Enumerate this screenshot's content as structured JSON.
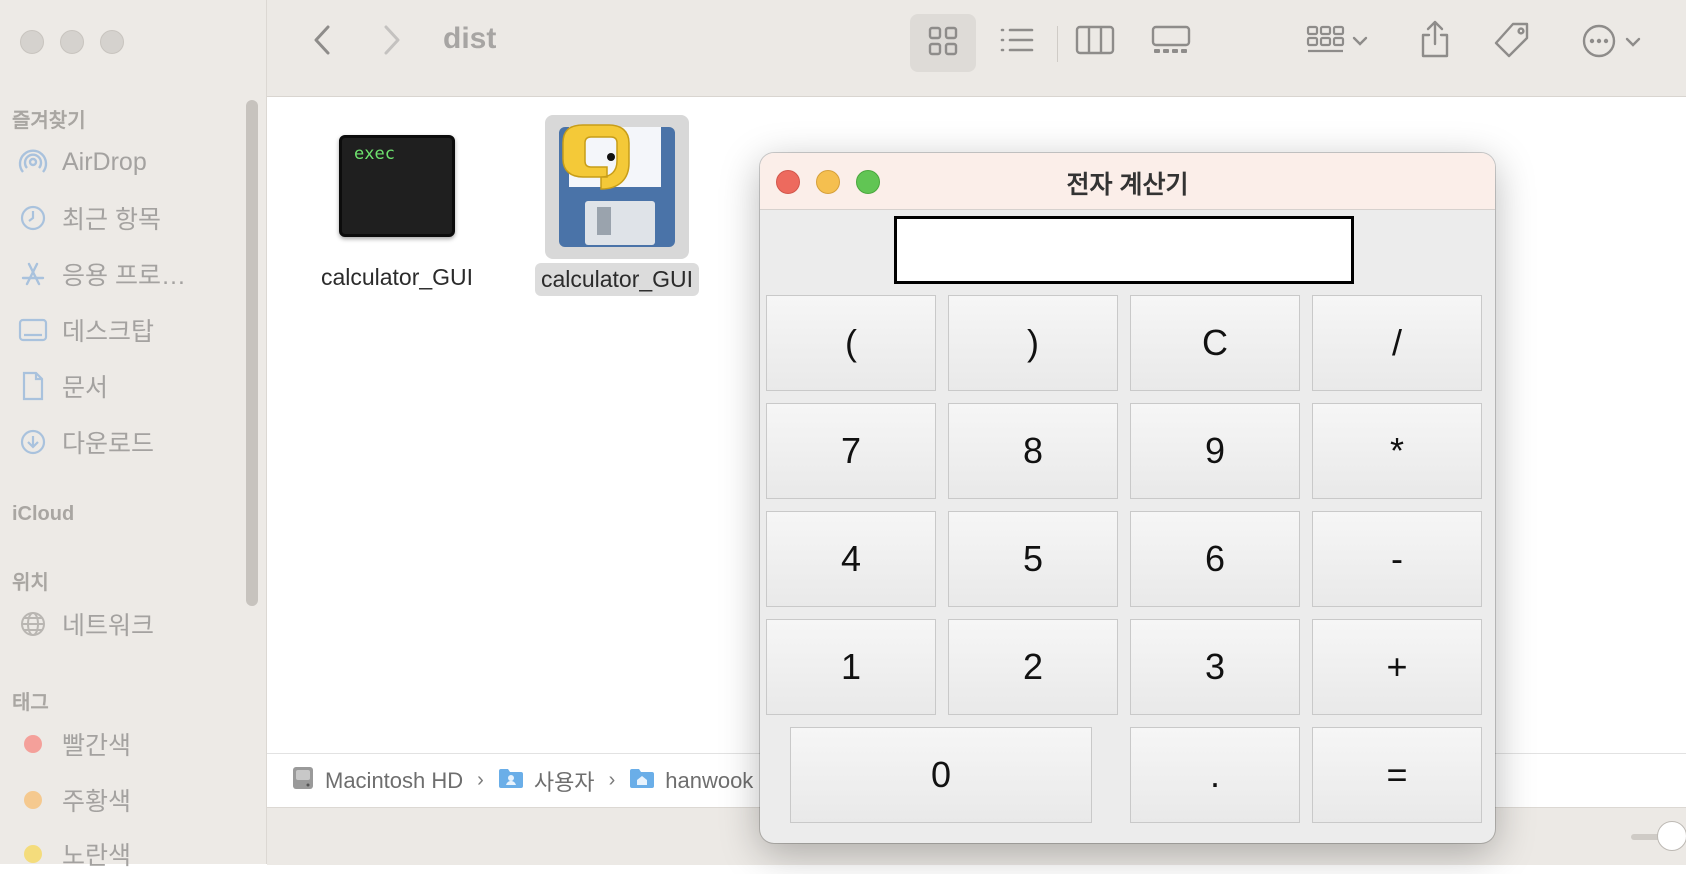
{
  "finder": {
    "folder_title": "dist",
    "sidebar": {
      "favorites_header": "즐겨찾기",
      "favorites": [
        {
          "label": "AirDrop",
          "icon": "airdrop-icon"
        },
        {
          "label": "최근 항목",
          "icon": "clock-icon"
        },
        {
          "label": "응용 프로…",
          "icon": "applications-icon"
        },
        {
          "label": "데스크탑",
          "icon": "desktop-icon"
        },
        {
          "label": "문서",
          "icon": "document-icon"
        },
        {
          "label": "다운로드",
          "icon": "download-icon"
        }
      ],
      "icloud_header": "iCloud",
      "locations_header": "위치",
      "locations": [
        {
          "label": "네트워크",
          "icon": "globe-icon"
        }
      ],
      "tags_header": "태그",
      "tags": [
        {
          "label": "빨간색",
          "color": "#f4a09a"
        },
        {
          "label": "주황색",
          "color": "#f5c98f"
        },
        {
          "label": "노란색",
          "color": "#f4dc7c"
        }
      ]
    },
    "files": [
      {
        "name": "calculator_GUI",
        "icon": "exec-terminal-icon",
        "icon_text": "exec",
        "selected": false
      },
      {
        "name": "calculator_GUI",
        "icon": "python-app-icon",
        "selected": true
      }
    ],
    "path": [
      {
        "label": "Macintosh HD",
        "icon": "hard-drive-icon"
      },
      {
        "label": "사용자",
        "icon": "users-folder-icon"
      },
      {
        "label": "hanwook",
        "icon": "home-folder-icon"
      }
    ]
  },
  "calculator": {
    "title": "전자 계산기",
    "display_value": "",
    "keys": [
      {
        "label": "(",
        "name": "open-paren"
      },
      {
        "label": ")",
        "name": "close-paren"
      },
      {
        "label": "C",
        "name": "clear"
      },
      {
        "label": "/",
        "name": "divide"
      },
      {
        "label": "7",
        "name": "7"
      },
      {
        "label": "8",
        "name": "8"
      },
      {
        "label": "9",
        "name": "9"
      },
      {
        "label": "*",
        "name": "multiply"
      },
      {
        "label": "4",
        "name": "4"
      },
      {
        "label": "5",
        "name": "5"
      },
      {
        "label": "6",
        "name": "6"
      },
      {
        "label": "-",
        "name": "minus"
      },
      {
        "label": "1",
        "name": "1"
      },
      {
        "label": "2",
        "name": "2"
      },
      {
        "label": "3",
        "name": "3"
      },
      {
        "label": "+",
        "name": "plus"
      },
      {
        "label": "0",
        "name": "0"
      },
      {
        "label": ".",
        "name": "decimal"
      },
      {
        "label": "=",
        "name": "equals"
      }
    ]
  },
  "colors": {
    "close": "#ed6a5e",
    "minimize": "#f5bf4f",
    "zoom": "#61c554"
  }
}
